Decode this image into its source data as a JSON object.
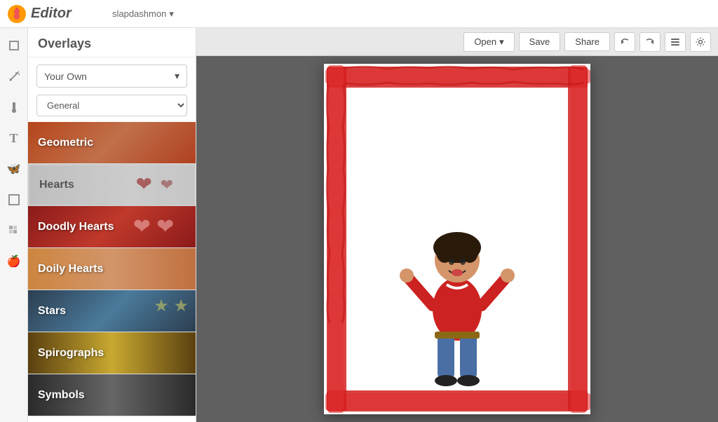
{
  "app": {
    "logo_text": "Editor",
    "user": "slapdashmon"
  },
  "header": {
    "open_label": "Open",
    "save_label": "Save",
    "share_label": "Share"
  },
  "sidebar": {
    "title": "Overlays",
    "dropdown_label": "Your Own",
    "category_label": "General",
    "items": [
      {
        "id": "geometric",
        "label": "Geometric",
        "class": "overlay-geometric"
      },
      {
        "id": "hearts",
        "label": "Hearts",
        "class": "overlay-hearts",
        "active": true
      },
      {
        "id": "doodly-hearts",
        "label": "Doodly Hearts",
        "class": "overlay-doodly-hearts"
      },
      {
        "id": "doily-hearts",
        "label": "Doily Hearts",
        "class": "overlay-doily-hearts"
      },
      {
        "id": "stars",
        "label": "Stars",
        "class": "overlay-stars"
      },
      {
        "id": "spirographs",
        "label": "Spirographs",
        "class": "overlay-spirographs"
      },
      {
        "id": "symbols",
        "label": "Symbols",
        "class": "overlay-symbols"
      }
    ]
  },
  "left_tools": [
    {
      "id": "crop",
      "icon": "⬜",
      "name": "crop-tool"
    },
    {
      "id": "magic",
      "icon": "✦",
      "name": "magic-tool"
    },
    {
      "id": "brush",
      "icon": "🖊",
      "name": "brush-tool"
    },
    {
      "id": "text",
      "icon": "T",
      "name": "text-tool"
    },
    {
      "id": "butterfly",
      "icon": "🦋",
      "name": "butterfly-tool"
    },
    {
      "id": "frame",
      "icon": "▭",
      "name": "frame-tool"
    },
    {
      "id": "grid",
      "icon": "⊞",
      "name": "grid-tool"
    },
    {
      "id": "apple",
      "icon": "🍎",
      "name": "apple-tool"
    }
  ]
}
